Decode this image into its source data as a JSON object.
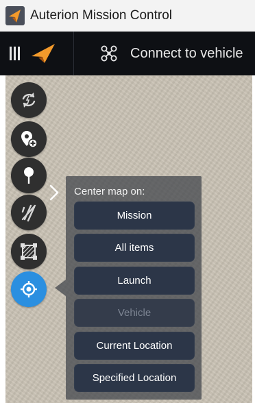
{
  "window": {
    "title": "Auterion Mission Control",
    "app_icon": "auterion-logo-icon"
  },
  "toolbar": {
    "menu_icon": "hamburger-icon",
    "logo_icon": "auterion-logo-icon",
    "connect_icon": "drone-icon",
    "connect_label": "Connect to vehicle"
  },
  "tools": [
    {
      "name": "sync-icon",
      "active": false
    },
    {
      "name": "add-waypoint-icon",
      "active": false
    },
    {
      "name": "roi-pin-icon",
      "active": false
    },
    {
      "name": "no-pattern-icon",
      "active": false
    },
    {
      "name": "survey-polygon-icon",
      "active": false
    },
    {
      "name": "center-map-icon",
      "active": true
    }
  ],
  "center_menu": {
    "title": "Center map on:",
    "options": [
      {
        "label": "Mission",
        "enabled": true
      },
      {
        "label": "All items",
        "enabled": true
      },
      {
        "label": "Launch",
        "enabled": true
      },
      {
        "label": "Vehicle",
        "enabled": false
      },
      {
        "label": "Current Location",
        "enabled": true
      },
      {
        "label": "Specified Location",
        "enabled": true
      }
    ]
  },
  "colors": {
    "accent": "#2b8fe0",
    "brand_orange": "#f39a2b",
    "toolbar_bg": "#0e1014",
    "menu_button_bg": "#2c3648"
  }
}
